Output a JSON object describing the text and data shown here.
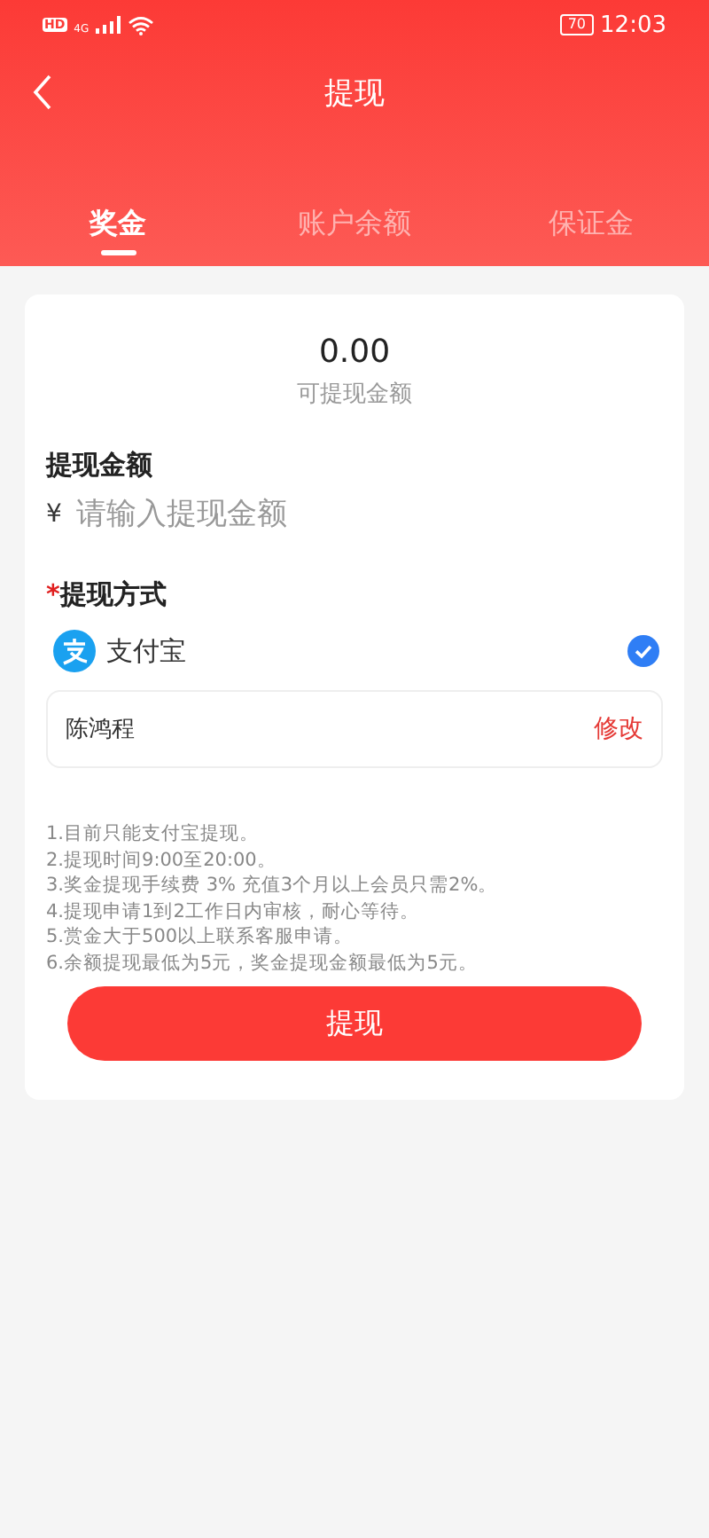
{
  "status_bar": {
    "hd": "HD",
    "network": "4G",
    "battery": "70",
    "time": "12:03"
  },
  "header": {
    "title": "提现"
  },
  "tabs": [
    {
      "label": "奖金",
      "selected": true
    },
    {
      "label": "账户余额",
      "selected": false
    },
    {
      "label": "保证金",
      "selected": false
    }
  ],
  "balance": {
    "amount": "0.00",
    "label": "可提现金额"
  },
  "amount_field": {
    "label": "提现金额",
    "currency": "¥",
    "placeholder": "请输入提现金额"
  },
  "method": {
    "required_mark": "*",
    "label": "提现方式",
    "options": [
      {
        "name": "支付宝",
        "selected": true
      }
    ],
    "account": {
      "name": "陈鸿程",
      "edit": "修改"
    }
  },
  "notes": [
    "1.目前只能支付宝提现。",
    "2.提现时间9:00至20:00。",
    "3.奖金提现手续费 3% 充值3个月以上会员只需2%。",
    "4.提现申请1到2工作日内审核，耐心等待。",
    "5.赏金大于500以上联系客服申请。",
    "6.余额提现最低为5元，奖金提现金额最低为5元。"
  ],
  "submit": "提现"
}
